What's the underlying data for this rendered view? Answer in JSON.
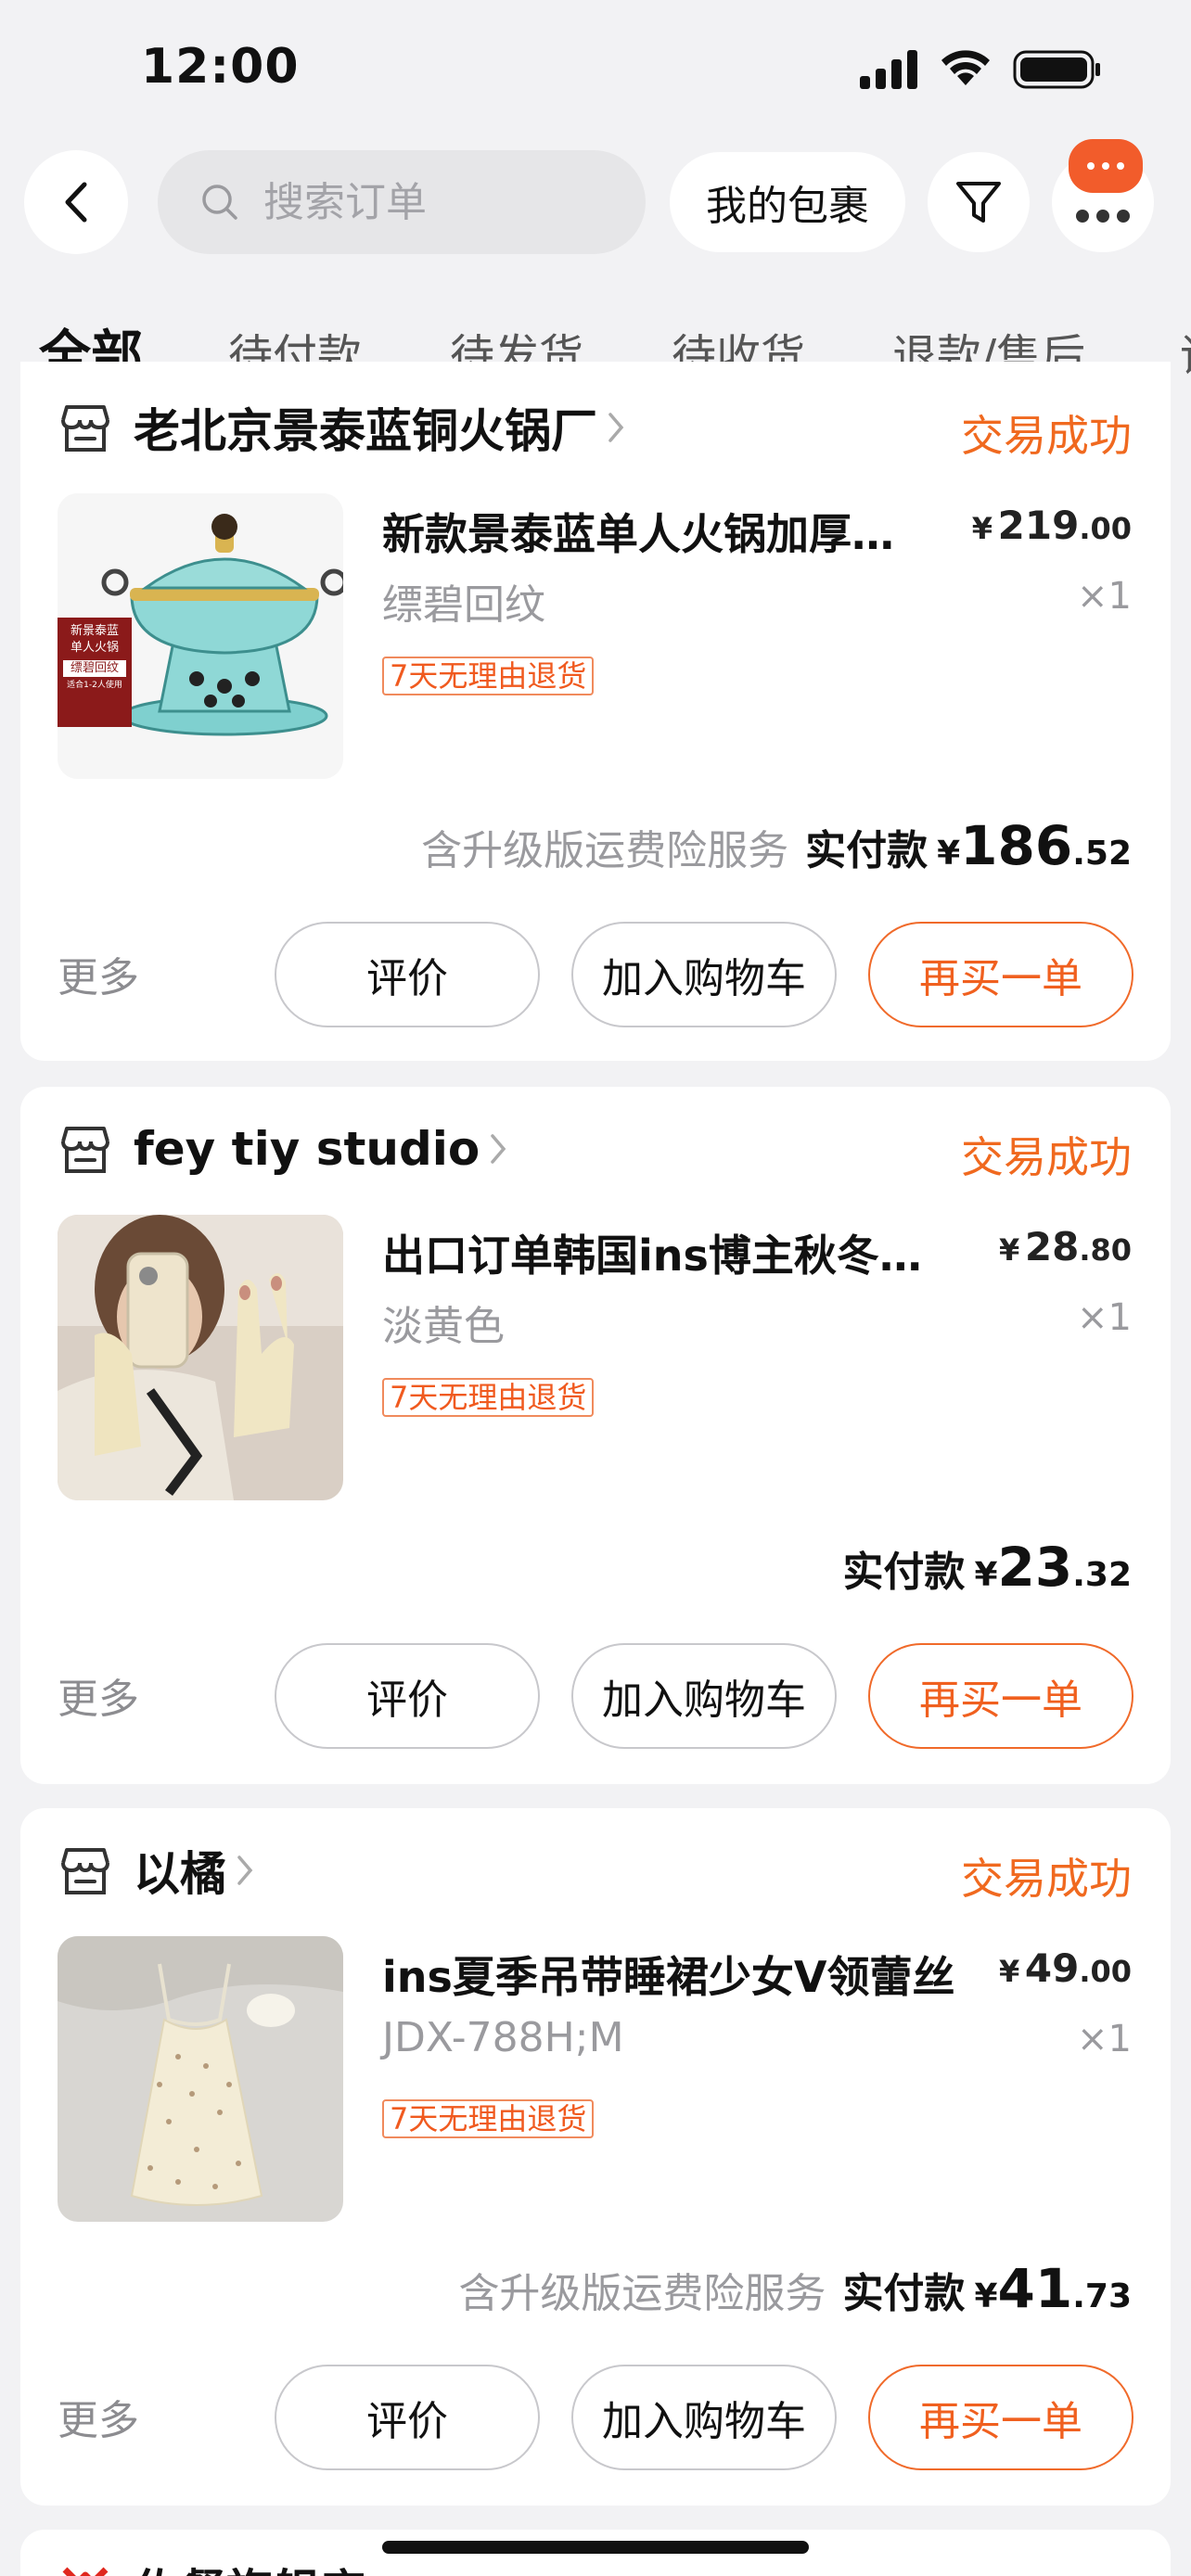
{
  "status_bar": {
    "time": "12:00",
    "icons": [
      "signal-icon",
      "wifi-icon",
      "battery-icon"
    ]
  },
  "header": {
    "search_placeholder": "搜索订单",
    "packages_label": "我的包裹",
    "icons": [
      "back-icon",
      "search-icon",
      "filter-icon",
      "more-dots-icon",
      "message-icon"
    ]
  },
  "tabs": [
    {
      "label": "全部",
      "active": true
    },
    {
      "label": "待付款"
    },
    {
      "label": "待发货"
    },
    {
      "label": "待收货"
    },
    {
      "label": "退款/售后"
    },
    {
      "label": "评价"
    }
  ],
  "orders": [
    {
      "shop": "老北京景泰蓝铜火锅厂",
      "status": "交易成功",
      "product": {
        "title": "新款景泰蓝单人火锅加厚纯铜",
        "spec": "缥碧回纹",
        "price_currency": "¥",
        "price_int": "219",
        "price_dec": ".00",
        "quantity": "×1",
        "tag": "7天无理由退货",
        "image_label_lines": [
          "新景泰蓝",
          "单人火锅",
          "缥碧回纹",
          "适合1-2人使用"
        ]
      },
      "insurance": "含升级版运费险服务",
      "paid_label": "实付款",
      "paid_currency": "¥",
      "paid_int": "186",
      "paid_dec": ".52",
      "more": "更多",
      "actions": {
        "review": "评价",
        "cart": "加入购物车",
        "rebuy": "再买一单"
      }
    },
    {
      "shop": "fey tiy studio",
      "status": "交易成功",
      "product": {
        "title": "出口订单韩国ins博主秋冬针织手套",
        "spec": "淡黄色",
        "price_currency": "¥",
        "price_int": "28",
        "price_dec": ".80",
        "quantity": "×1",
        "tag": "7天无理由退货"
      },
      "insurance": "",
      "paid_label": "实付款",
      "paid_currency": "¥",
      "paid_int": "23",
      "paid_dec": ".32",
      "more": "更多",
      "actions": {
        "review": "评价",
        "cart": "加入购物车",
        "rebuy": "再买一单"
      }
    },
    {
      "shop": "以橘",
      "status": "交易成功",
      "product": {
        "title": "ins夏季吊带睡裙少女V领蕾丝",
        "spec": "JDX-788H;M",
        "price_currency": "¥",
        "price_int": "49",
        "price_dec": ".00",
        "quantity": "×1",
        "tag": "7天无理由退货"
      },
      "insurance": "含升级版运费险服务",
      "paid_label": "实付款",
      "paid_currency": "¥",
      "paid_int": "41",
      "paid_dec": ".73",
      "more": "更多",
      "actions": {
        "review": "评价",
        "cart": "加入购物车",
        "rebuy": "再买一单"
      }
    }
  ],
  "next_card_shop_partial": "佐餐旗舰店",
  "colors": {
    "accent": "#f0691f",
    "background": "#f2f2f4",
    "badge": "#f25c2b"
  }
}
